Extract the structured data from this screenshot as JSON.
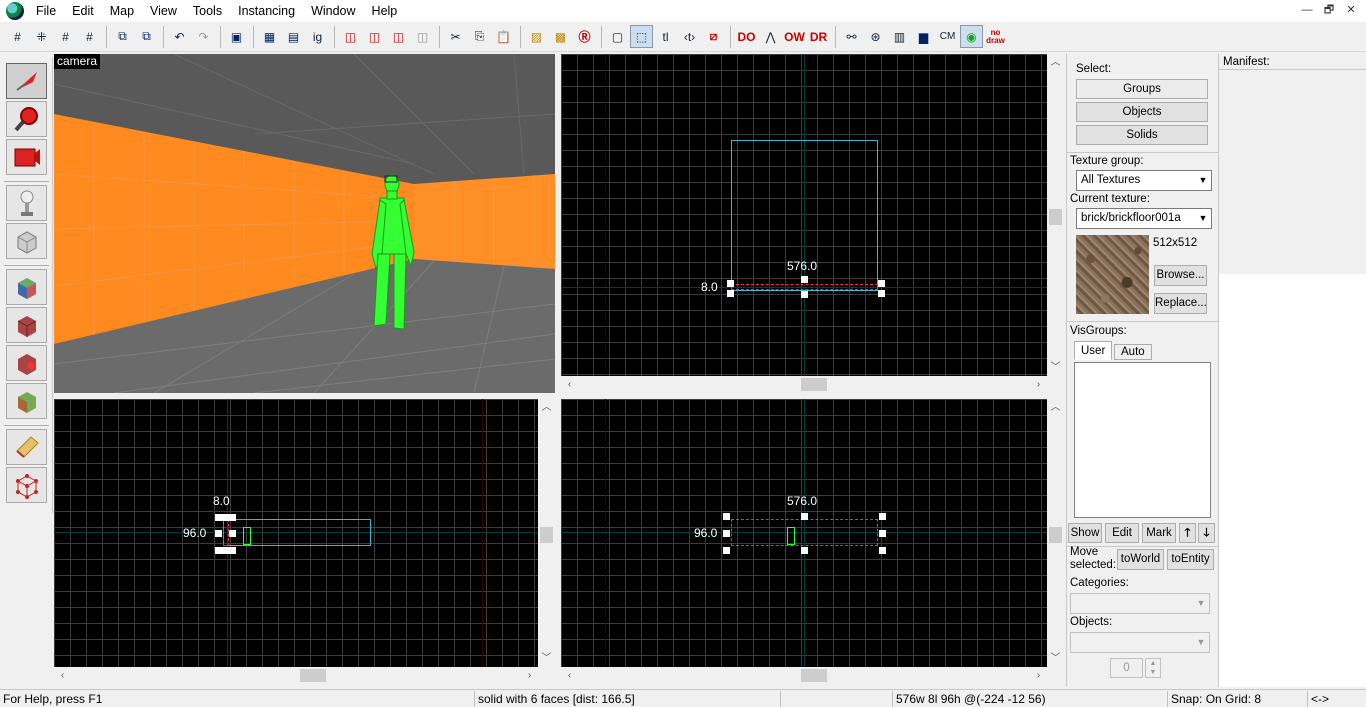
{
  "menubar": {
    "items": [
      "File",
      "Edit",
      "Map",
      "View",
      "Tools",
      "Instancing",
      "Window",
      "Help"
    ],
    "window_controls": [
      "—",
      "🗗",
      "✕"
    ]
  },
  "toolbar": {
    "buttons": [
      "#",
      "⁜",
      "#",
      "#",
      "⧉",
      "⧉",
      "↶",
      "↷",
      "▣",
      "▦",
      "▤",
      "ig",
      "◫",
      "◫",
      "◫",
      "◫",
      "✂",
      "⎘",
      "📋",
      "▨",
      "▩",
      "Ⓡ",
      "▢",
      "⬚",
      "tl",
      "‹t›",
      "⧄",
      "DO",
      "⋀",
      "OW",
      "DR",
      "⚯",
      "⊛",
      "▥",
      "▆",
      "CM",
      "◉",
      "no draw"
    ]
  },
  "palette": {
    "tools": [
      "selection-tool",
      "magnify-tool",
      "camera-tool",
      "entity-tool",
      "block-tool",
      "texture-application-tool",
      "apply-current-texture-tool",
      "decal-tool",
      "overlay-tool",
      "clipping-tool",
      "vertex-tool"
    ]
  },
  "viewport_camera": {
    "label": "camera"
  },
  "viewport_top": {
    "width_label": "576.0",
    "height_label": "8.0"
  },
  "viewport_front": {
    "width_label": "8.0",
    "height_label": "96.0"
  },
  "viewport_side": {
    "width_label": "576.0",
    "height_label": "96.0"
  },
  "right_panel": {
    "select_label": "Select:",
    "groups_button": "Groups",
    "objects_button": "Objects",
    "solids_button": "Solids",
    "texture_group_label": "Texture group:",
    "texture_group_value": "All Textures",
    "current_texture_label": "Current texture:",
    "current_texture_value": "brick/brickfloor001a",
    "texture_size": "512x512",
    "browse_button": "Browse...",
    "replace_button": "Replace...",
    "visgroups_label": "VisGroups:",
    "tab_user": "User",
    "tab_auto": "Auto",
    "show_button": "Show",
    "edit_button": "Edit",
    "mark_button": "Mark",
    "move_selected_label": "Move selected:",
    "to_world_button": "toWorld",
    "to_entity_button": "toEntity",
    "categories_label": "Categories:",
    "objects_label": "Objects:",
    "spinner_value": "0"
  },
  "manifest": {
    "label": "Manifest:"
  },
  "statusbar": {
    "help": "For Help, press F1",
    "selection": "solid with 6 faces  [dist: 166.5]",
    "dimensions": "576w 8l 96h @(-224 -12 56)",
    "snap": "Snap: On Grid: 8",
    "extra": "<->"
  },
  "colors": {
    "wall_orange": "#ff8a1f",
    "entity_green": "#33ff33",
    "selection_blue": "#3fb5d6",
    "selection_red": "#ff3030"
  }
}
